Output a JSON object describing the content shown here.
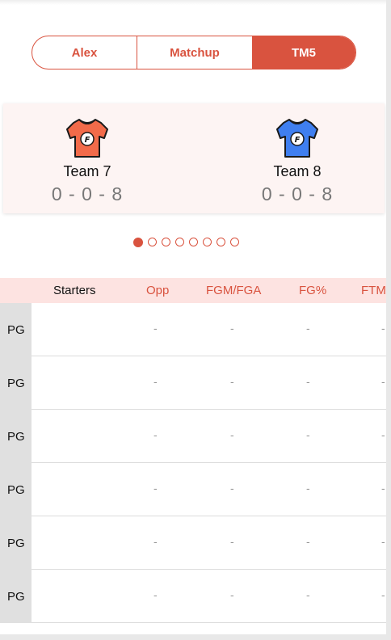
{
  "tabs": [
    {
      "label": "Alex",
      "active": false
    },
    {
      "label": "Matchup",
      "active": false
    },
    {
      "label": "TM5",
      "active": true
    }
  ],
  "matchup": {
    "team1": {
      "name": "Team 7",
      "record": "0 - 0 - 8",
      "jersey_color": "#f26b4a",
      "icon": "jersey-icon"
    },
    "team2": {
      "name": "Team 8",
      "record": "0 - 0 - 8",
      "jersey_color": "#3f7ff0",
      "icon": "jersey-icon"
    }
  },
  "pager": {
    "count": 8,
    "active": 0
  },
  "table": {
    "columns": [
      "Starters",
      "Opp",
      "FGM/FGA",
      "FG%",
      "FTM"
    ],
    "rows": [
      {
        "pos": "PG",
        "player": "",
        "opp": "-",
        "fgm_fga": "-",
        "fg_pct": "-",
        "ftm": "-"
      },
      {
        "pos": "PG",
        "player": "",
        "opp": "-",
        "fgm_fga": "-",
        "fg_pct": "-",
        "ftm": "-"
      },
      {
        "pos": "PG",
        "player": "",
        "opp": "-",
        "fgm_fga": "-",
        "fg_pct": "-",
        "ftm": "-"
      },
      {
        "pos": "PG",
        "player": "",
        "opp": "-",
        "fgm_fga": "-",
        "fg_pct": "-",
        "ftm": "-"
      },
      {
        "pos": "PG",
        "player": "",
        "opp": "-",
        "fgm_fga": "-",
        "fg_pct": "-",
        "ftm": "-"
      },
      {
        "pos": "PG",
        "player": "",
        "opp": "-",
        "fgm_fga": "-",
        "fg_pct": "-",
        "ftm": "-"
      }
    ]
  },
  "colors": {
    "accent": "#d9533f",
    "header_bg": "#fde3e1",
    "card_bg": "#fdf4f3"
  }
}
